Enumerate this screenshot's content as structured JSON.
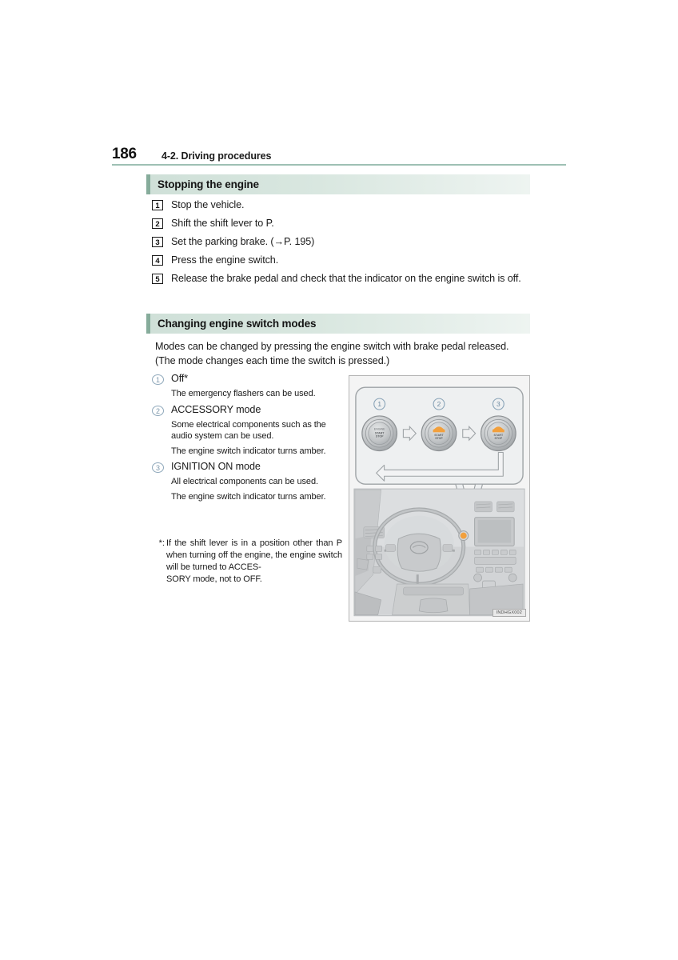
{
  "page": {
    "number": "186",
    "header_title": "4-2. Driving procedures"
  },
  "sections": {
    "stopping": {
      "heading": "Stopping the engine",
      "steps": [
        {
          "num": "1",
          "text": "Stop the vehicle."
        },
        {
          "num": "2",
          "text": "Shift the shift lever to P."
        },
        {
          "num": "3",
          "text": "Set the parking brake. (→P. 195)"
        },
        {
          "num": "4",
          "text": "Press the engine switch."
        },
        {
          "num": "5",
          "text": "Release the brake pedal and check that the indicator on the engine switch is off."
        }
      ]
    },
    "changing": {
      "heading": "Changing engine switch modes",
      "intro": "Modes can be changed by pressing the engine switch with brake pedal released. (The mode changes each time the switch is pressed.)",
      "modes": [
        {
          "marker": "1",
          "title": "Off*",
          "body": [
            "The emergency flashers can be used."
          ]
        },
        {
          "marker": "2",
          "title": "ACCESSORY mode",
          "body": [
            "Some electrical components such as the audio system can be used.",
            "The engine switch indicator turns amber."
          ]
        },
        {
          "marker": "3",
          "title": "IGNITION ON mode",
          "body": [
            "All electrical components can be used.",
            "The engine switch indicator turns amber."
          ]
        }
      ],
      "footnote": {
        "mark": "*:",
        "text": "If the shift lever is in a position other than P when turning off the engine, the engine switch will be turned to ACCES-",
        "last_line": "SORY mode, not to OFF."
      }
    }
  },
  "illustration": {
    "code": "INDHGX002",
    "callout_labels": [
      "1",
      "2",
      "3"
    ],
    "button_text_lines": [
      "ENGINE",
      "START",
      "STOP"
    ]
  },
  "colors": {
    "heading_accent": "#86ac9b",
    "heading_bg": "#d4e3db",
    "rule": "#9ec0b4",
    "circle_marker": "#7d97ab",
    "indicator_amber": "#f2a03d"
  }
}
